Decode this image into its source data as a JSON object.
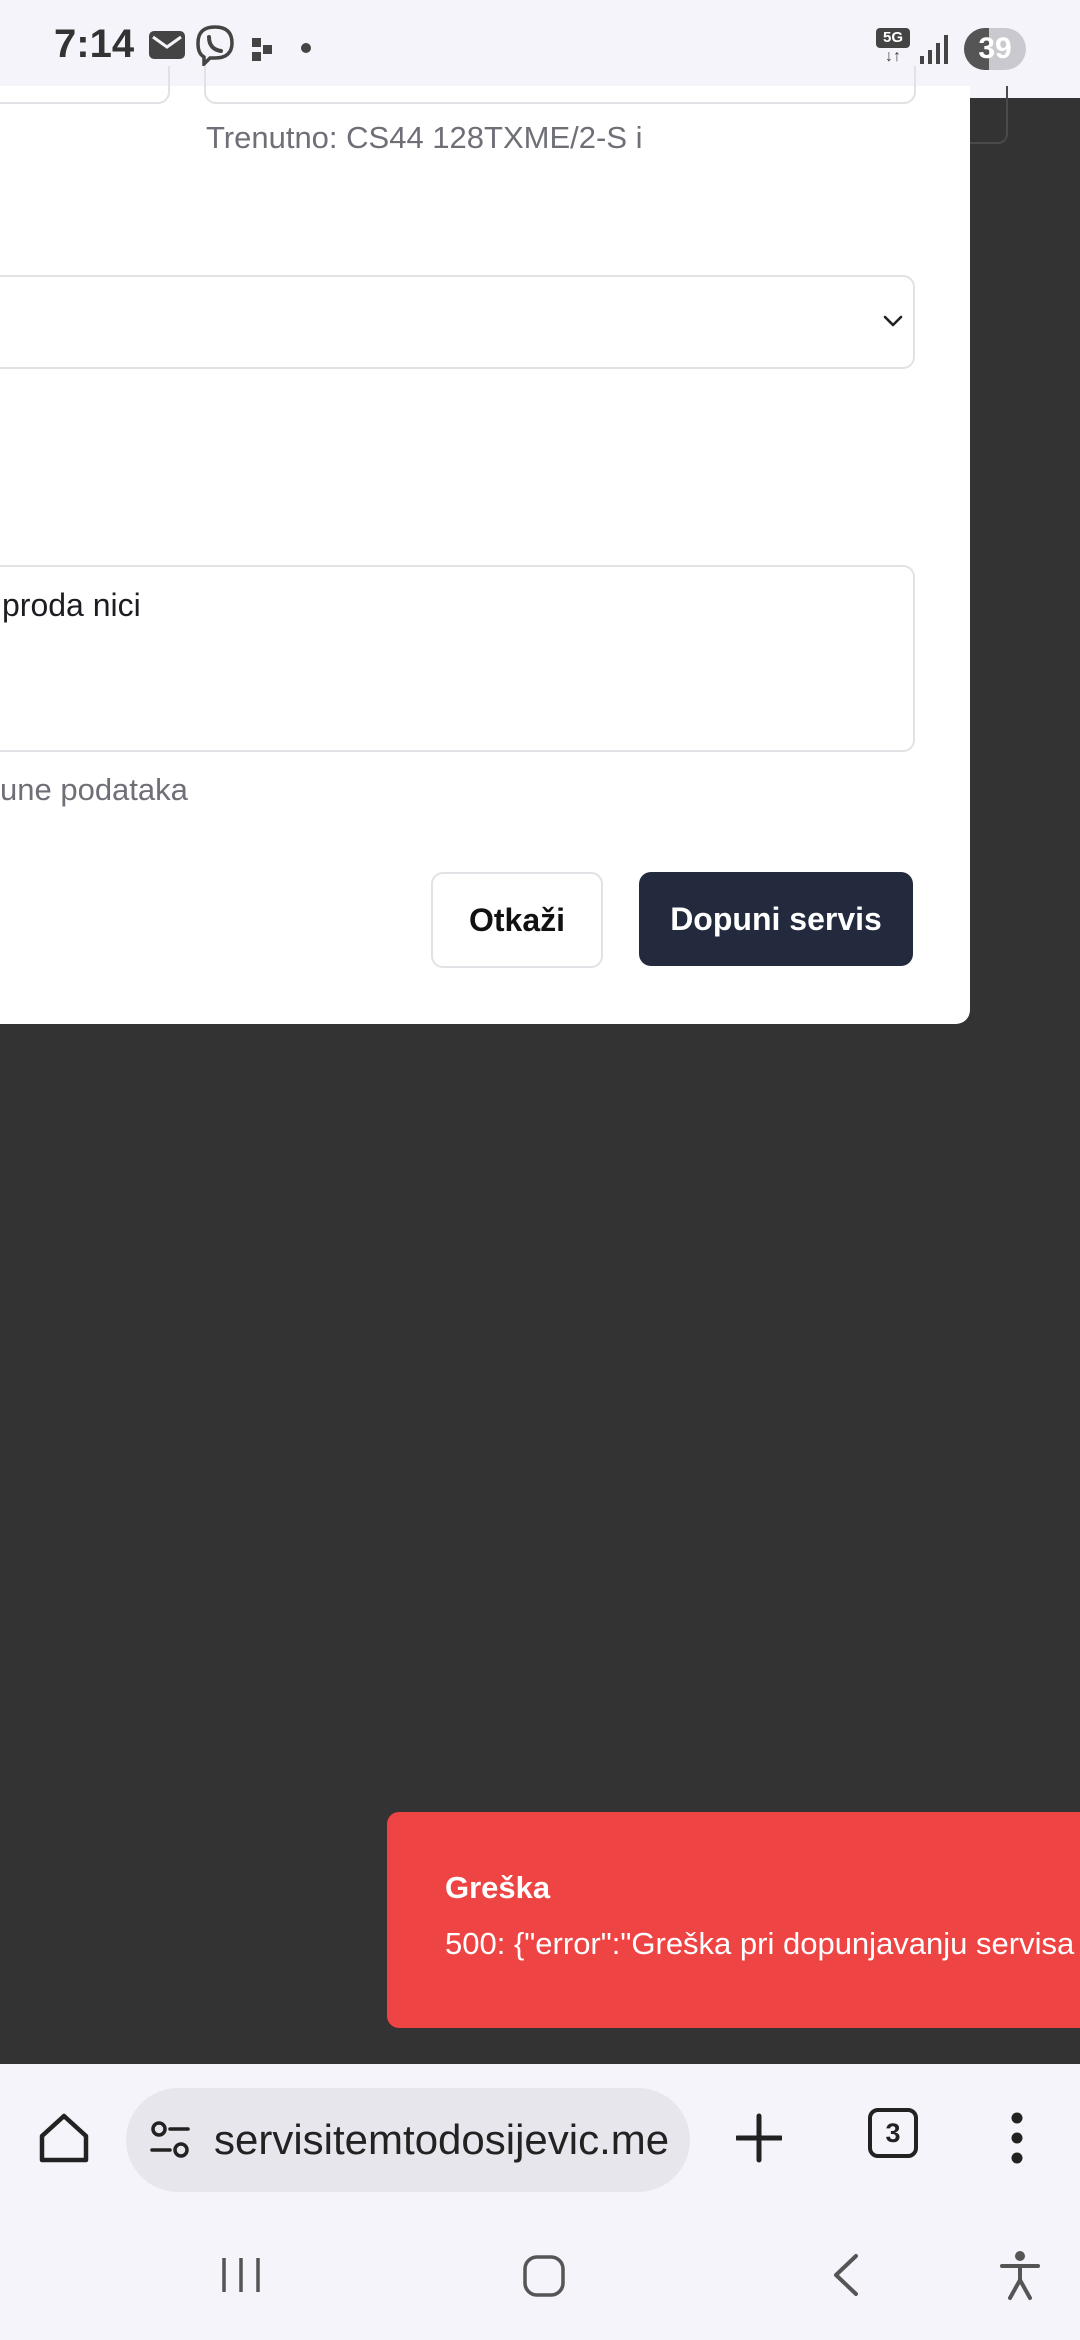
{
  "status_bar": {
    "time": "7:14",
    "network_label": "5G",
    "battery_level": "39",
    "icons": [
      "mail-icon",
      "viber-icon",
      "app-notification-icon",
      "dot-icon",
      "5g-icon",
      "signal-icon",
      "battery-icon"
    ]
  },
  "dialog": {
    "current_model_text": "Trenutno: CS44 128TXME/2-S i",
    "select_value": "",
    "textarea_value": "proda nici",
    "hint_text": "une podataka",
    "cancel_label": "Otkaži",
    "submit_label": "Dopuni servis"
  },
  "toast": {
    "title": "Greška",
    "message": "500: {\"error\":\"Greška pri dopunjavanju servisa",
    "color": "#ef4444"
  },
  "browser": {
    "url": "servisitemtodosijevic.me",
    "tab_count": "3",
    "icons": [
      "home-icon",
      "site-settings-icon",
      "new-tab-icon",
      "tabs-icon",
      "menu-icon"
    ]
  },
  "navigation": {
    "icons": [
      "recents-icon",
      "home-button-icon",
      "back-icon",
      "accessibility-icon"
    ]
  },
  "colors": {
    "primary_button": "#232a3d",
    "overlay": "#333333",
    "error_toast": "#ef4444"
  }
}
